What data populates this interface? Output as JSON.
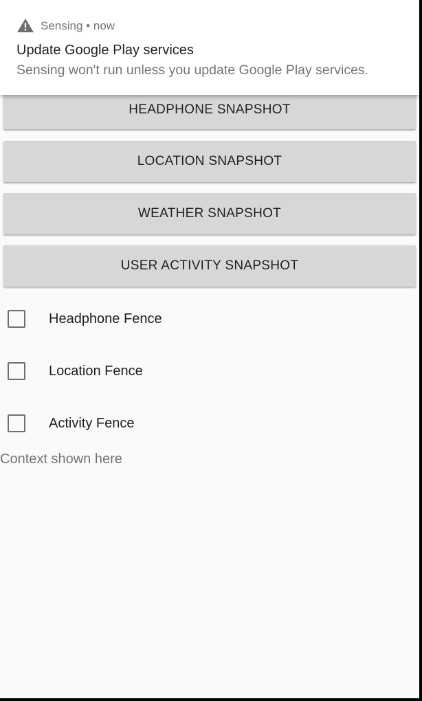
{
  "notification": {
    "app_name": "Sensing",
    "separator": "•",
    "time": "now",
    "title": "Update Google Play services",
    "body": "Sensing won't run unless you update Google Play services.",
    "icon": "warning-icon"
  },
  "buttons": {
    "headphone_snapshot": "HEADPHONE SNAPSHOT",
    "location_snapshot": "LOCATION SNAPSHOT",
    "weather_snapshot": "WEATHER SNAPSHOT",
    "user_activity_snapshot": "USER ACTIVITY SNAPSHOT"
  },
  "fences": [
    {
      "label": "Headphone Fence",
      "checked": false
    },
    {
      "label": "Location Fence",
      "checked": false
    },
    {
      "label": "Activity Fence",
      "checked": false
    }
  ],
  "context_text": "Context shown here",
  "colors": {
    "background": "#fafafa",
    "button": "#d6d7d7",
    "notification_bg": "#ffffff"
  }
}
